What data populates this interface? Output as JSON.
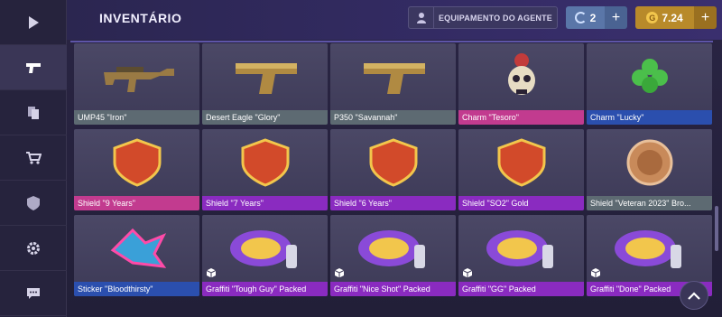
{
  "header": {
    "title": "INVENTÁRIO",
    "equip_label": "EQUIPAMENTO DO AGENTE",
    "coins_c": "2",
    "coins_g": "7.24",
    "plus": "+"
  },
  "colors": {
    "gray": "#5d6a72",
    "pink": "#c23b8f",
    "blue": "#2b4fae",
    "purple": "#8a2bc0"
  },
  "sidebar": {
    "items": [
      {
        "icon": "play-icon"
      },
      {
        "icon": "pistol-icon",
        "active": true
      },
      {
        "icon": "cards-icon"
      },
      {
        "icon": "cart-icon"
      },
      {
        "icon": "clan-icon"
      },
      {
        "icon": "gear-icon"
      },
      {
        "icon": "chat-icon"
      }
    ]
  },
  "items": [
    {
      "name": "UMP45 \"Iron\"",
      "rarity": "gray",
      "icon": "smg-icon"
    },
    {
      "name": "Desert Eagle \"Glory\"",
      "rarity": "gray",
      "icon": "pistol-icon"
    },
    {
      "name": "P350 \"Savannah\"",
      "rarity": "gray",
      "icon": "pistol-icon"
    },
    {
      "name": "Charm \"Tesoro\"",
      "rarity": "pink",
      "icon": "skull-charm-icon"
    },
    {
      "name": "Charm \"Lucky\"",
      "rarity": "blue",
      "icon": "clover-charm-icon"
    },
    {
      "name": "Shield \"9 Years\"",
      "rarity": "pink",
      "icon": "shield-icon"
    },
    {
      "name": "Shield \"7 Years\"",
      "rarity": "purple",
      "icon": "shield-icon"
    },
    {
      "name": "Shield \"6 Years\"",
      "rarity": "purple",
      "icon": "shield-icon"
    },
    {
      "name": "Shield \"SO2\" Gold",
      "rarity": "purple",
      "icon": "shield-icon"
    },
    {
      "name": "Shield \"Veteran 2023\" Bro...",
      "rarity": "gray",
      "icon": "medal-icon"
    },
    {
      "name": "Sticker \"Bloodthirsty\"",
      "rarity": "blue",
      "icon": "shark-sticker-icon"
    },
    {
      "name": "Graffiti \"Tough Guy\" Packed",
      "rarity": "purple",
      "icon": "graffiti-icon",
      "packed": true
    },
    {
      "name": "Graffiti \"Nice Shot\" Packed",
      "rarity": "purple",
      "icon": "graffiti-icon",
      "packed": true
    },
    {
      "name": "Graffiti \"GG\" Packed",
      "rarity": "purple",
      "icon": "graffiti-icon",
      "packed": true
    },
    {
      "name": "Graffiti \"Done\" Packed",
      "rarity": "purple",
      "icon": "graffiti-icon",
      "packed": true
    }
  ]
}
